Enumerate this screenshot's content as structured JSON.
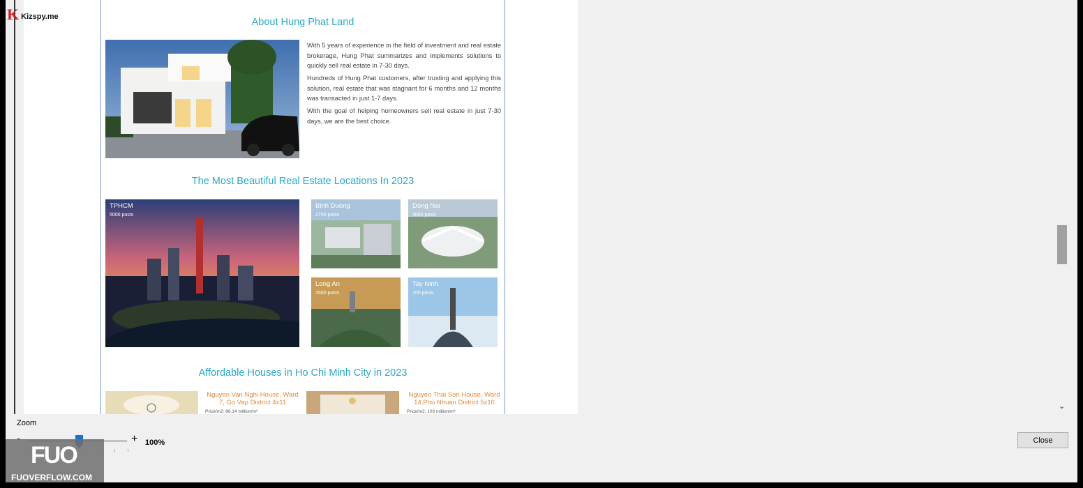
{
  "brand": {
    "logo_letter": "K",
    "logo_text": "Kizspy.me"
  },
  "watermark": {
    "logo": "FUO",
    "text": "FUOVERFLOW.COM"
  },
  "about": {
    "title": "About Hung Phat Land",
    "paragraphs": [
      "With 5 years of experience in the field of investment and real estate brokerage, Hung Phat summarizes and implements solutions to quickly sell real estate in 7-30 days.",
      "Hundreds of Hung Phat customers, after trusting and applying this solution, real estate that was stagnant for 6 months and 12 months was transacted in just 1-7 days.",
      "With the goal of helping homeowners sell real estate in just 7-30 days, we are the best choice."
    ]
  },
  "locations": {
    "title": "The Most Beautiful Real Estate Locations In 2023",
    "items": [
      {
        "name": "TPHCM",
        "posts": "5000 posts"
      },
      {
        "name": "Binh Duong",
        "posts": "2700 posts"
      },
      {
        "name": "Dong Nai",
        "posts": "3000 posts"
      },
      {
        "name": "Long An",
        "posts": "1500 posts"
      },
      {
        "name": "Tay Ninh",
        "posts": "700 posts"
      }
    ]
  },
  "houses": {
    "title": "Affordable Houses in Ho Chi Minh City in 2023",
    "items": [
      {
        "title": "Nguyen Van Nghi House, Ward 7, Go Vap District 4x11",
        "price": "Price/m2: 86.14 million/m²"
      },
      {
        "title": "Nguyen Thai Son House, Ward 14,Phu Nhuan District 5x10",
        "price": "Price/m2: 103 million/m²"
      }
    ]
  },
  "zoom": {
    "label": "Zoom",
    "minus": "-",
    "plus": "+",
    "value": "100%",
    "level_percent": 100
  },
  "buttons": {
    "close": "Close"
  },
  "icons": {
    "scroll_down": "chevron-down-icon"
  }
}
